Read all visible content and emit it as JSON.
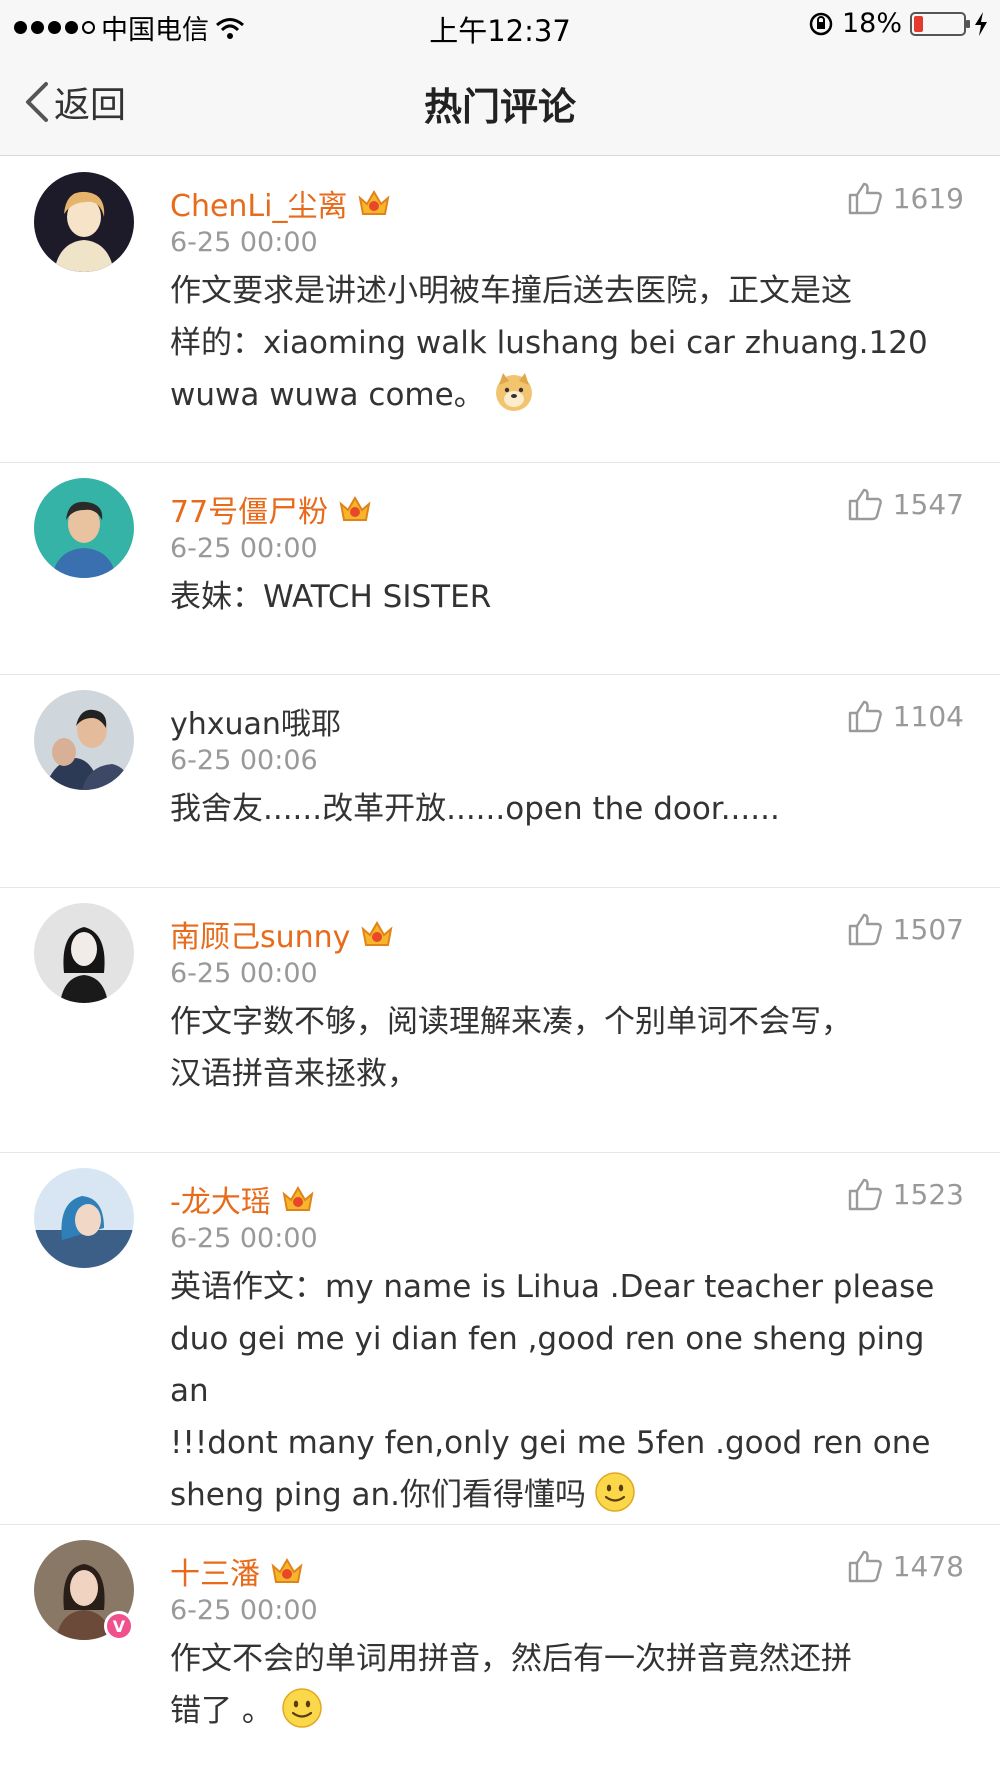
{
  "status_bar": {
    "carrier": "中国电信",
    "time": "上午12:37",
    "battery": "18%",
    "battery_level": 0.18
  },
  "nav": {
    "back_label": "返回",
    "title": "热门评论"
  },
  "comments": [
    {
      "username": "ChenLi_尘离",
      "vip": true,
      "time": "6-25 00:00",
      "likes": "1619",
      "lines": [
        "作文要求是讲述小明被车撞后送去医院，正文是这",
        "样的：xiaoming walk lushang bei car zhuang.120",
        "wuwa wuwa come。"
      ],
      "emoji": "doge-emoji"
    },
    {
      "username": "77号僵尸粉",
      "vip": true,
      "time": "6-25 00:00",
      "likes": "1547",
      "lines": [
        "表妹：WATCH SISTER"
      ]
    },
    {
      "username": "yhxuan哦耶",
      "vip": false,
      "time": "6-25 00:06",
      "likes": "1104",
      "lines": [
        "我舍友......改革开放......open the door......"
      ]
    },
    {
      "username": "南顾己sunny",
      "vip": true,
      "time": "6-25 00:00",
      "likes": "1507",
      "lines": [
        "作文字数不够，阅读理解来凑，个别单词不会写，",
        "汉语拼音来拯救，"
      ]
    },
    {
      "username": "-龙大瑶",
      "vip": true,
      "time": "6-25 00:00",
      "likes": "1523",
      "lines": [
        "英语作文：my name is Lihua .Dear teacher please",
        "duo gei me yi dian fen ,good ren one sheng ping an",
        "!!!dont many fen,only gei me 5fen .good ren one",
        "sheng ping an.你们看得懂吗"
      ],
      "emoji": "smile-emoji"
    },
    {
      "username": "十三潘",
      "vip": true,
      "time": "6-25 00:00",
      "likes": "1478",
      "lines": [
        "作文不会的单词用拼音，然后有一次拼音竟然还拼",
        "错了 。"
      ],
      "emoji": "smile-emoji",
      "verified": true
    }
  ],
  "colors": {
    "vip_name": "#e86b1c",
    "meta": "#999999",
    "divider": "#e6e6e6"
  }
}
